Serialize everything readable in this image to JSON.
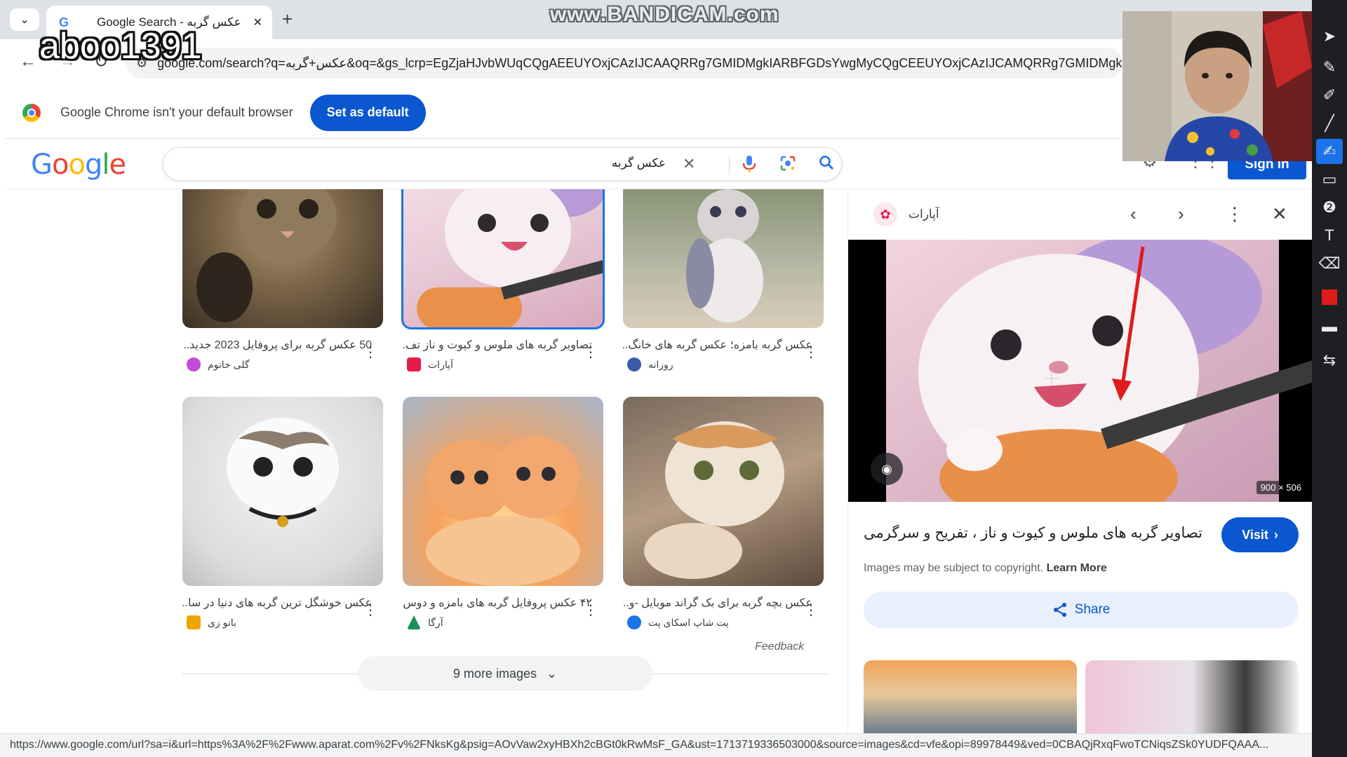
{
  "browser": {
    "tab_title": "Google Search - عکس گربه",
    "tab_close": "✕",
    "new_tab": "+",
    "url": "google.com/search?q=عکس+گربه&oq=&gs_lcrp=EgZjaHJvbWUqCQgAEEUYOxjCAzIJCAAQRRg7GMIDMgkIARBFGDsYwgMyCQgCEEUYOxjCAzIJCAMQRRg7GMIDMgkIBBBFGDsYwgMyCQgFEEUYOxjCAz",
    "status_url": "https://www.google.com/url?sa=i&url=https%3A%2F%2Fwww.aparat.com%2Fv%2FNksKg&psig=AOvVaw2xyHBXh2cBGt0kRwMsF_GA&ust=1713719336503000&source=images&cd=vfe&opi=89978449&ved=0CBAQjRxqFwoTCNiqsZSk0YUDFQAAA..."
  },
  "overlays": {
    "watermark": "www.BANDICAM.com",
    "username": "aboo1391"
  },
  "infobar": {
    "message": "Google Chrome isn't your default browser",
    "button": "Set as default"
  },
  "google": {
    "logo_letters": [
      "G",
      "o",
      "o",
      "g",
      "l",
      "e"
    ],
    "logo_colors": [
      "#4285f4",
      "#ea4335",
      "#fbbc05",
      "#4285f4",
      "#34a853",
      "#ea4335"
    ],
    "query": "عکس گربه",
    "signin": "Sign in"
  },
  "results": [
    {
      "caption": "50 عکس گربه برای پروفایل 2023 جدید...",
      "source": "گلی خانوم",
      "source_color": "#c04bd6"
    },
    {
      "caption": "تصاویر گربه های ملوس و کیوت و ناز تف...",
      "source": "آپارات",
      "source_color": "#e6194b"
    },
    {
      "caption": "عکس گربه بامزه؛ عکس گربه های خانگ...",
      "source": "روزانه",
      "source_color": "#3b5ba9"
    },
    {
      "caption": "عکس خوشگل ترین گربه های دنیا در سا...",
      "source": "بانو زی",
      "source_color": "#f0a500"
    },
    {
      "caption": "۴۲ عکس پروفایل گربه های بامزه و دوس...",
      "source": "آرگا",
      "source_color": "#1b8f5a"
    },
    {
      "caption": "عکس بچه گربه برای بک گراند موبایل -و...",
      "source": "پت شاپ اسکای پت",
      "source_color": "#1a73e8"
    }
  ],
  "feedback": "Feedback",
  "more_images": "9 more images",
  "panel": {
    "source": "آپارات",
    "dims": "900 × 506",
    "title": "تصاویر گربه های ملوس و کیوت و ناز ، تفریح و سرگرمی",
    "visit": "Visit",
    "copyright": "Images may be subject to copyright.",
    "learn_more": "Learn More",
    "share": "Share"
  }
}
